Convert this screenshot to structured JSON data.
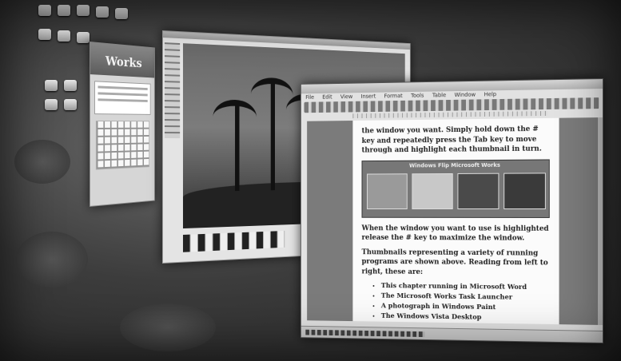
{
  "desktop": {
    "icon_names": [
      "recycle-bin-icon",
      "computer-icon",
      "documents-icon",
      "network-icon",
      "folder-icon",
      "drive-icon",
      "shortcut-icon",
      "media-icon"
    ]
  },
  "works_window": {
    "logo_text": "Works"
  },
  "word_window": {
    "menu": [
      "File",
      "Edit",
      "View",
      "Insert",
      "Format",
      "Tools",
      "Table",
      "Window",
      "Help"
    ],
    "paragraphs": [
      "the window you want. Simply hold down the # key and repeatedly press the Tab key to move through and highlight each thumbnail in turn.",
      "When the window you want to use is highlighted release the # key to maximize the window.",
      "Thumbnails representing a variety of running programs are shown above. Reading from left to right, these are:"
    ],
    "bullets": [
      "This chapter running in Microsoft Word",
      "The Microsoft Works Task Launcher",
      "A photograph in Windows Paint",
      "The Windows Vista Desktop"
    ],
    "figure_caption": "Windows Flip Microsoft Works"
  },
  "colors": {
    "desktop_dark": "#242424",
    "page": "#fbfbfb",
    "workspace": "#7b7b7b"
  }
}
